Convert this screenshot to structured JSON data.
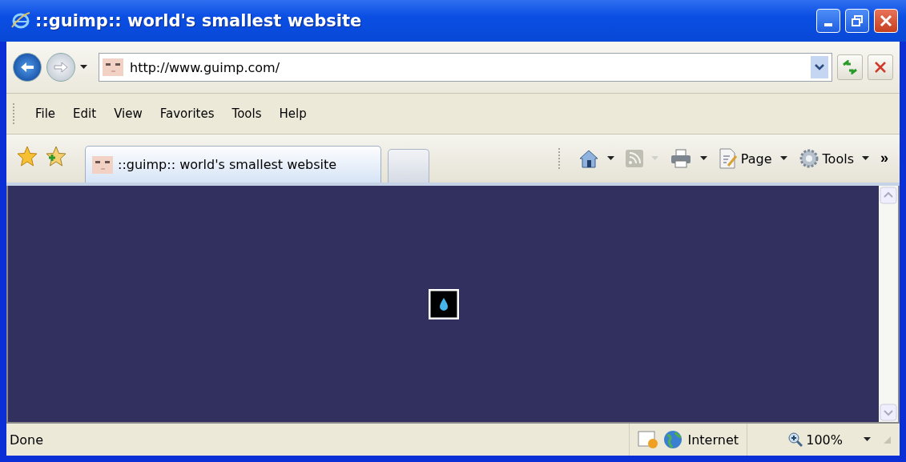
{
  "window": {
    "title": "::guimp:: world's smallest website"
  },
  "address_bar": {
    "value": "http://www.guimp.com/"
  },
  "menu": [
    {
      "label": "File"
    },
    {
      "label": "Edit"
    },
    {
      "label": "View"
    },
    {
      "label": "Favorites"
    },
    {
      "label": "Tools"
    },
    {
      "label": "Help"
    }
  ],
  "tabs": [
    {
      "label": "::guimp:: world's smallest website",
      "selected": true
    }
  ],
  "command_bar": [
    {
      "kind": "home",
      "disabled": false
    },
    {
      "kind": "feeds",
      "disabled": true
    },
    {
      "kind": "print",
      "disabled": false
    },
    {
      "kind": "page",
      "label": "Page",
      "disabled": false
    },
    {
      "kind": "tools",
      "label": "Tools",
      "disabled": false
    }
  ],
  "chevron": "»",
  "status_bar": {
    "text": "Done",
    "zone": "Internet",
    "zoom": "100%"
  }
}
